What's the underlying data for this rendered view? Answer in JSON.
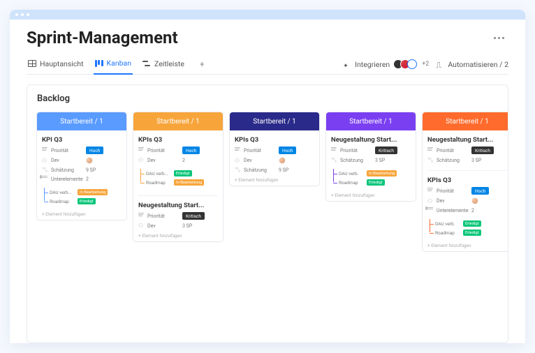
{
  "page": {
    "title": "Sprint-Management"
  },
  "tabs": {
    "main": "Hauptansicht",
    "kanban": "Kanban",
    "timeline": "Zeitleiste",
    "add": "+"
  },
  "rightActions": {
    "integrate": "Integrieren",
    "integrate_badge": "+2",
    "automate": "Automatisieren / 2"
  },
  "board": {
    "title": "Backlog"
  },
  "labels": {
    "priority": "Priorität",
    "dev": "Dev",
    "estimate": "Schätzung",
    "subitems": "Unterelemente",
    "addEl": "+ Element hinzufügen"
  },
  "pills": {
    "hoch": "Hoch",
    "kritisch": "Kritisch",
    "erledigt": "Erledigt",
    "inBearb": "In Bearbeitung",
    "inBearbShort": "In Bearbeitung"
  },
  "sp": {
    "nine": "9 SP",
    "two": "2",
    "three": "3 SP"
  },
  "subs": {
    "dauVerb": "DAU verb...",
    "dauVerb2": "DAU verb.",
    "roadmap": "Roadmap"
  },
  "columns": [
    {
      "header": "Startbereit / 1",
      "color": "#5a9bff"
    },
    {
      "header": "Startbereit / 1",
      "color": "#f7a53b"
    },
    {
      "header": "Startbereit / 1",
      "color": "#2a2a8a"
    },
    {
      "header": "Startbereit / 1",
      "color": "#7b3ff2"
    },
    {
      "header": "Startbereit / 1",
      "color": "#ff6b2c"
    }
  ],
  "cards": {
    "kpiQ3": "KPI Q3",
    "kpisQ3": "KPIs Q3",
    "neugest": "Neugestaltung Start..."
  }
}
